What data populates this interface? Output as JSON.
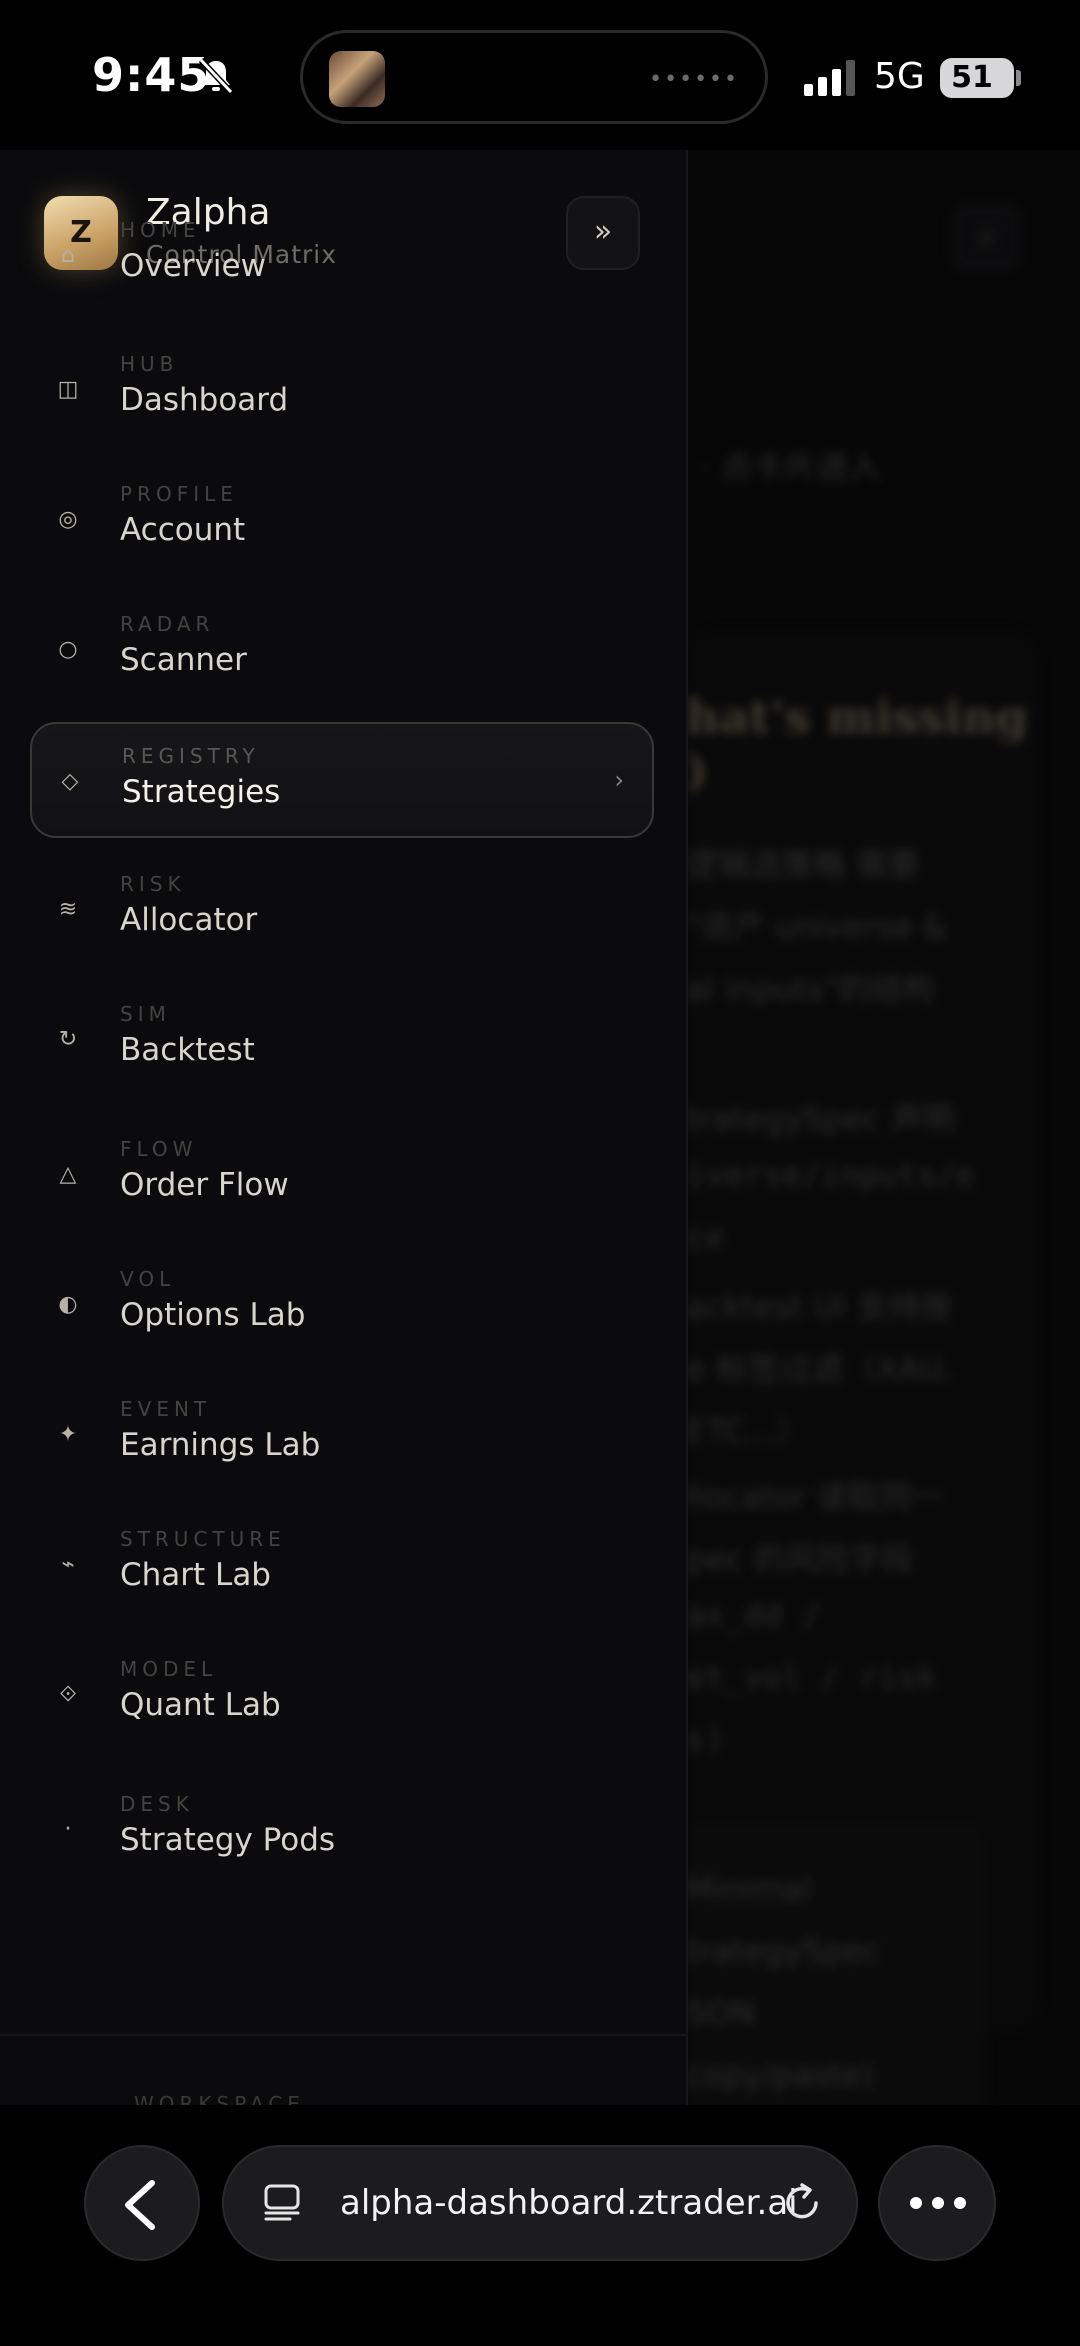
{
  "status_bar": {
    "time": "9:45",
    "network": "5G",
    "battery": "51"
  },
  "background_page": {
    "intro_line": "· 点卡片进入",
    "heading_line1": "hat's missing",
    "heading_line2": ")",
    "lines": [
      "逻辑选策略 需要",
      "\"资产 universe &",
      "al inputs\"的结构",
      "trategySpec 声明",
      "iverse/inputs/e",
      "ce",
      "acktest UI 支持按",
      "e 标签过滤（XAU,",
      "ETC...）",
      "llocator 读取同一",
      "pec 的风险字段",
      "ax_dd /",
      "et_vol / risk",
      "s)"
    ],
    "card_lines": [
      "Minimal",
      "trategySpec",
      "SON",
      "copy/paste)"
    ]
  },
  "drawer": {
    "logo_letter": "Z",
    "title": "Zalpha",
    "subtitle": "Control Matrix",
    "collapse_label": "»",
    "items": [
      {
        "kicker": "HOME",
        "label": "Overview",
        "icon": "⌂",
        "icon_name": "home-icon"
      },
      {
        "kicker": "HUB",
        "label": "Dashboard",
        "icon": "◫",
        "icon_name": "panel-icon"
      },
      {
        "kicker": "PROFILE",
        "label": "Account",
        "icon": "◎",
        "icon_name": "profile-icon"
      },
      {
        "kicker": "RADAR",
        "label": "Scanner",
        "icon": "○",
        "icon_name": "radar-icon"
      },
      {
        "kicker": "REGISTRY",
        "label": "Strategies",
        "icon": "◇",
        "icon_name": "diamond-icon",
        "active": true
      },
      {
        "kicker": "RISK",
        "label": "Allocator",
        "icon": "≋",
        "icon_name": "wave-icon"
      },
      {
        "kicker": "SIM",
        "label": "Backtest",
        "icon": "↻",
        "icon_name": "loop-icon"
      },
      {
        "kicker": "FLOW",
        "label": "Order Flow",
        "icon": "△",
        "icon_name": "triangle-icon"
      },
      {
        "kicker": "VOL",
        "label": "Options Lab",
        "icon": "◐",
        "icon_name": "half-circle-icon"
      },
      {
        "kicker": "EVENT",
        "label": "Earnings Lab",
        "icon": "✦",
        "icon_name": "sparkle-icon"
      },
      {
        "kicker": "STRUCTURE",
        "label": "Chart Lab",
        "icon": "⌁",
        "icon_name": "zigzag-icon"
      },
      {
        "kicker": "MODEL",
        "label": "Quant Lab",
        "icon": "⟐",
        "icon_name": "diamond-dot-icon"
      },
      {
        "kicker": "DESK",
        "label": "Strategy Pods",
        "icon": "·",
        "icon_name": "dot-icon"
      }
    ],
    "active_chevron": "›",
    "workspace_label": "WORKSPACE"
  },
  "browser": {
    "url": "alpha-dashboard.ztrader.ai"
  }
}
